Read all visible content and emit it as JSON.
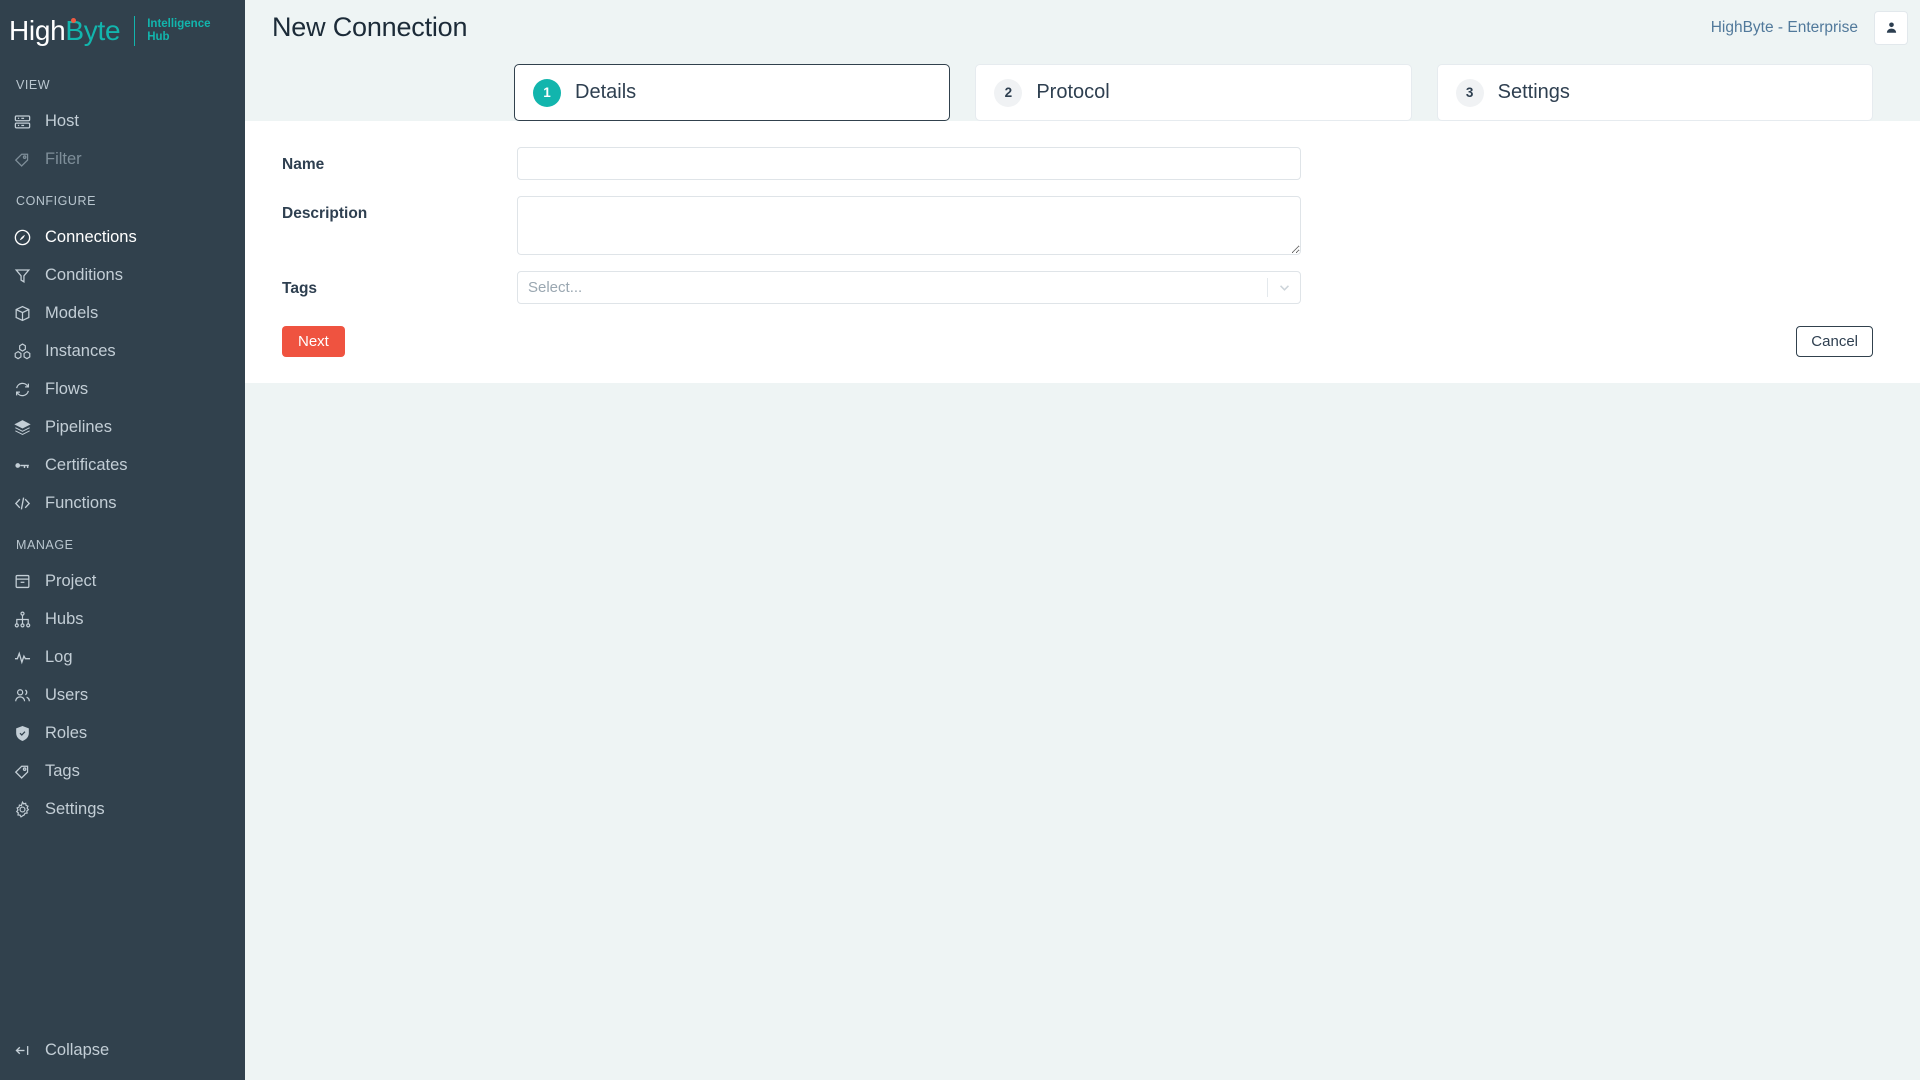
{
  "brand": {
    "name_part1": "High",
    "name_part2": "Byte",
    "product_line1": "Intelligence",
    "product_line2": "Hub",
    "accent_teal": "#12b5ad",
    "accent_red": "#ef5340",
    "sidebar_bg": "#31414d",
    "page_bg": "#eef4f4"
  },
  "sidebar": {
    "sections": [
      {
        "title": "VIEW",
        "items": [
          {
            "label": "Host",
            "icon": "server-icon",
            "state": "default"
          },
          {
            "label": "Filter",
            "icon": "tag-icon",
            "state": "disabled"
          }
        ]
      },
      {
        "title": "CONFIGURE",
        "items": [
          {
            "label": "Connections",
            "icon": "plug-circle-icon",
            "state": "active"
          },
          {
            "label": "Conditions",
            "icon": "funnel-icon",
            "state": "default"
          },
          {
            "label": "Models",
            "icon": "box-icon",
            "state": "default"
          },
          {
            "label": "Instances",
            "icon": "cubes-icon",
            "state": "default"
          },
          {
            "label": "Flows",
            "icon": "refresh-icon",
            "state": "default"
          },
          {
            "label": "Pipelines",
            "icon": "layers-icon",
            "state": "default"
          },
          {
            "label": "Certificates",
            "icon": "key-icon",
            "state": "default"
          },
          {
            "label": "Functions",
            "icon": "code-icon",
            "state": "default"
          }
        ]
      },
      {
        "title": "MANAGE",
        "items": [
          {
            "label": "Project",
            "icon": "archive-icon",
            "state": "default"
          },
          {
            "label": "Hubs",
            "icon": "sitemap-icon",
            "state": "default"
          },
          {
            "label": "Log",
            "icon": "pulse-icon",
            "state": "default"
          },
          {
            "label": "Users",
            "icon": "users-icon",
            "state": "default"
          },
          {
            "label": "Roles",
            "icon": "shield-check-icon",
            "state": "default"
          },
          {
            "label": "Tags",
            "icon": "tag-icon",
            "state": "default"
          },
          {
            "label": "Settings",
            "icon": "gear-icon",
            "state": "default"
          }
        ]
      }
    ],
    "collapse": {
      "label": "Collapse",
      "icon": "collapse-left-icon"
    }
  },
  "header": {
    "title": "New Connection",
    "tenant": "HighByte - Enterprise",
    "account_icon": "user-icon"
  },
  "wizard": {
    "steps": [
      {
        "number": "1",
        "label": "Details",
        "active": true
      },
      {
        "number": "2",
        "label": "Protocol",
        "active": false
      },
      {
        "number": "3",
        "label": "Settings",
        "active": false
      }
    ]
  },
  "form": {
    "fields": [
      {
        "label": "Name",
        "type": "text",
        "value": "",
        "placeholder": ""
      },
      {
        "label": "Description",
        "type": "textarea",
        "value": "",
        "placeholder": ""
      },
      {
        "label": "Tags",
        "type": "select",
        "value": "",
        "placeholder": "Select...",
        "selected_display": "Select...",
        "options": []
      }
    ],
    "next_label": "Next",
    "cancel_label": "Cancel"
  }
}
